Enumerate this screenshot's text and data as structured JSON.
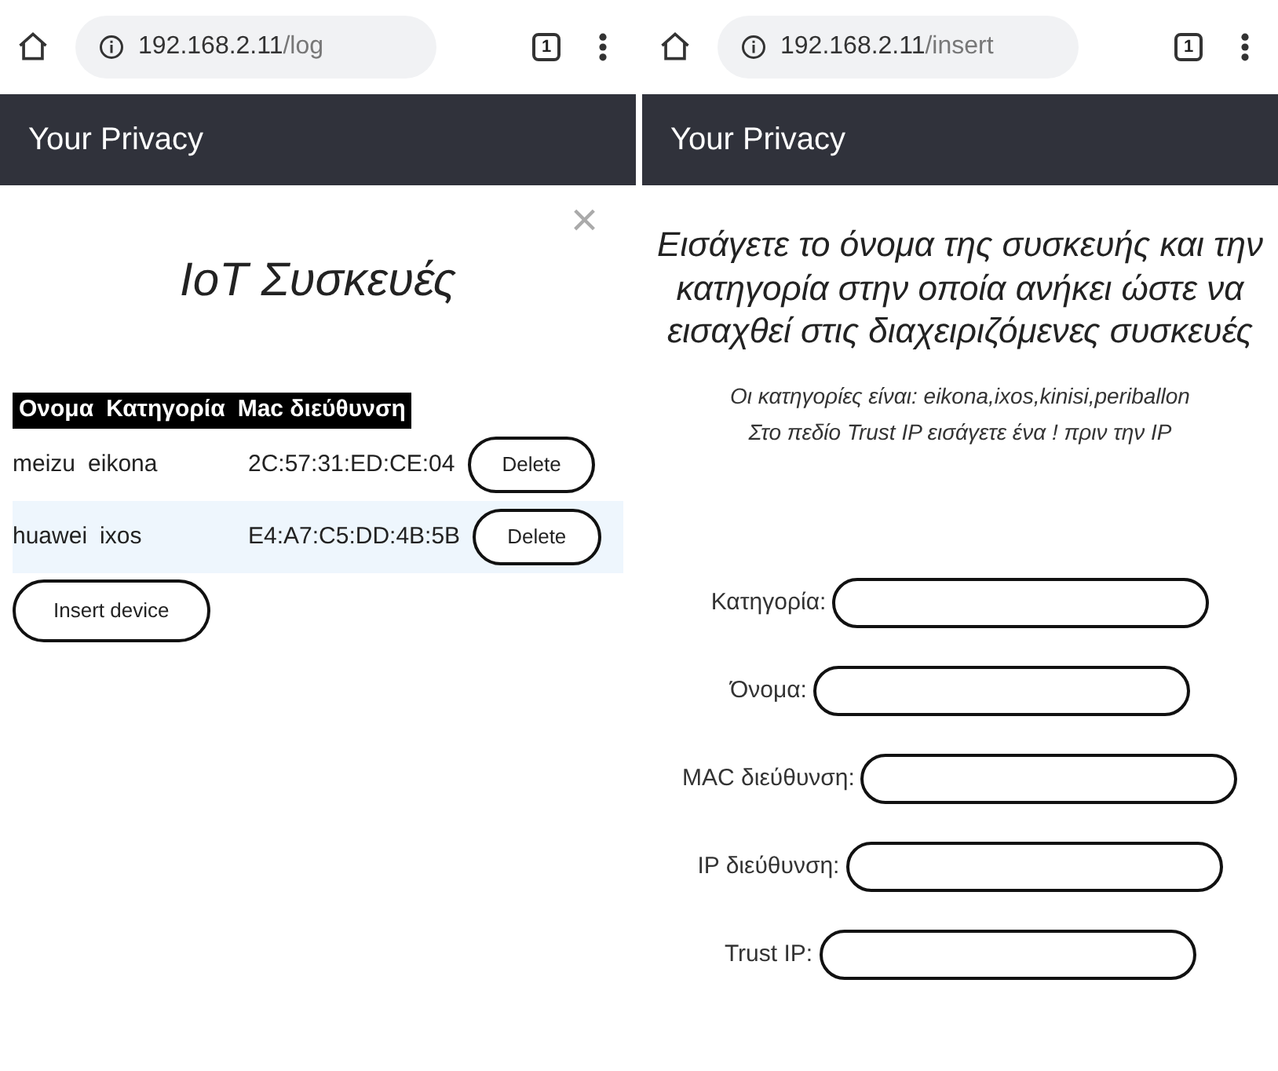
{
  "screens": [
    {
      "kind": "device_list",
      "address_bar": {
        "host": "192.168.2.11",
        "path": "/log",
        "tab_count": "1"
      },
      "navbar": {
        "brand": "Your Privacy"
      },
      "close": "×",
      "title": "IoT Συσκευές",
      "table": {
        "columns": [
          "Ονομα",
          "Κατηγορία",
          "Mac διεύθυνση"
        ],
        "rows": [
          {
            "cells": [
              "meizu",
              "eikona",
              "2C:57:31:ED:CE:04"
            ],
            "button": "Delete",
            "highlighted": false
          },
          {
            "cells": [
              "huawei",
              "ixos",
              "E4:A7:C5:DD:4B:5B"
            ],
            "button": "Delete",
            "highlighted": true
          }
        ]
      },
      "insert_button": "Insert device"
    },
    {
      "kind": "insert_form",
      "address_bar": {
        "host": "192.168.2.11",
        "path": "/insert",
        "tab_count": "1"
      },
      "navbar": {
        "brand": "Your Privacy"
      },
      "heading": "Εισάγετε το όνομα της συσκευής και την κατηγορία στην οποία ανήκει ώστε να εισαχθεί στις διαχειριζόμενες συσκευές",
      "notes": [
        "Οι κατηγορίες είναι: eikona,ixos,kinisi,periballon",
        "Στο πεδίο Trust IP εισάγετε ένα ! πριν την IP"
      ],
      "fields": [
        {
          "label": "Κατηγορία:"
        },
        {
          "label": "Όνομα:"
        },
        {
          "label": "MAC διεύθυνση:"
        },
        {
          "label": "IP διεύθυνση:"
        },
        {
          "label": "Trust IP:"
        }
      ]
    }
  ]
}
